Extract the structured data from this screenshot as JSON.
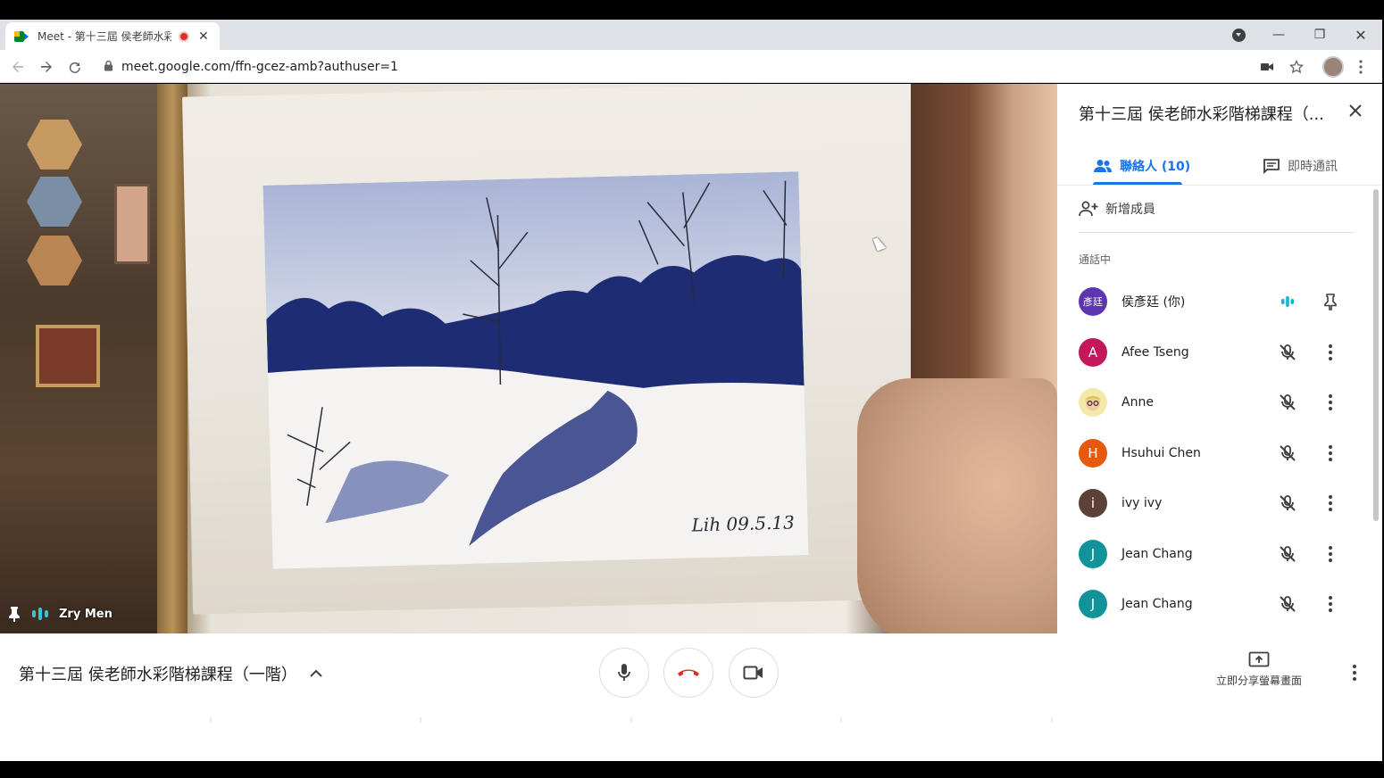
{
  "browser": {
    "tab_title": "Meet - 第十三屆 侯老師水彩",
    "url": "meet.google.com/ffn-gcez-amb?authuser=1",
    "window_controls": {
      "minimize": "—",
      "maximize": "❐",
      "close": "✕"
    },
    "tab_close": "✕"
  },
  "video": {
    "speaker_name": "Zry Men",
    "signature": "Lih 09.5.13"
  },
  "panel": {
    "title": "第十三屆 侯老師水彩階梯課程（...",
    "tabs": [
      {
        "label": "聯絡人 (10)",
        "active": true
      },
      {
        "label": "即時通訊",
        "active": false
      }
    ],
    "add_member_label": "新增成員",
    "section_label": "通話中",
    "participants": [
      {
        "initial": "彥廷",
        "name": "侯彥廷 (你)",
        "color": "#5e35b1",
        "status": "speaking",
        "action": "pin"
      },
      {
        "initial": "A",
        "name": "Afee Tseng",
        "color": "#c2185b",
        "status": "muted",
        "action": "more"
      },
      {
        "initial": "",
        "name": "Anne",
        "color": "#f2e6a6",
        "status": "muted",
        "action": "more",
        "photo": true
      },
      {
        "initial": "H",
        "name": "Hsuhui Chen",
        "color": "#e8590c",
        "status": "muted",
        "action": "more"
      },
      {
        "initial": "i",
        "name": "ivy ivy",
        "color": "#5d4037",
        "status": "muted",
        "action": "more"
      },
      {
        "initial": "J",
        "name": "Jean Chang",
        "color": "#12939a",
        "status": "muted",
        "action": "more"
      },
      {
        "initial": "J",
        "name": "Jean Chang",
        "color": "#12939a",
        "status": "muted",
        "action": "more"
      }
    ]
  },
  "bottom": {
    "meeting_title": "第十三屆 侯老師水彩階梯課程（一階）",
    "present_label": "立即分享螢幕畫面"
  },
  "colors": {
    "accent": "#1a73e8",
    "hangup": "#d93025",
    "speaking": "#12b5cb"
  }
}
